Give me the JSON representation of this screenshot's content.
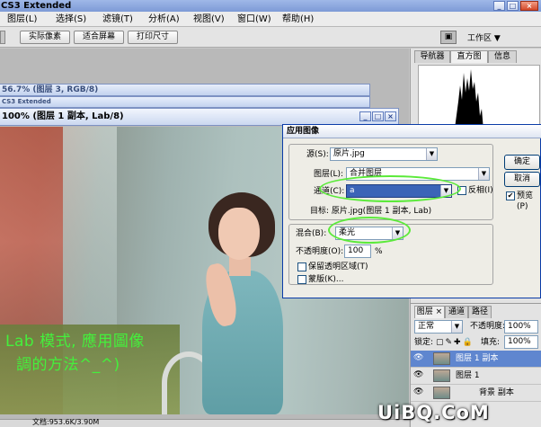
{
  "app": {
    "title": "CS3 Extended"
  },
  "menu": [
    "图层(L)",
    "选择(S)",
    "滤镜(T)",
    "分析(A)",
    "视图(V)",
    "窗口(W)",
    "帮助(H)"
  ],
  "options_bar": {
    "actual_pixels": "实际像素",
    "fit_screen": "适合屏幕",
    "print_size": "打印尺寸",
    "workspace": "工作区 ▼"
  },
  "doc1": {
    "title": "56.7% (图层 3, RGB/8)"
  },
  "doc2": {
    "title": "CS3 Extended"
  },
  "doc3": {
    "title": "100% (图层 1 副本, Lab/8)"
  },
  "panel_tabs": [
    "导航器",
    "直方图",
    "信息"
  ],
  "dialog": {
    "title": "应用图像",
    "source_label": "源(S):",
    "source_value": "原片.jpg",
    "layer_label": "图层(L):",
    "layer_value": "合并图层",
    "channel_label": "通道(C):",
    "channel_value": "a",
    "invert_label": "反相(I)",
    "target_text": "目标:  原片.jpg(图层 1 副本, Lab)",
    "blend_label": "混合(B):",
    "blend_value": "柔光",
    "opacity_label": "不透明度(O):",
    "opacity_value": "100",
    "opacity_unit": "%",
    "preserve_label": "保留透明区域(T)",
    "mask_label": "蒙版(K)...",
    "ok": "确定",
    "cancel": "取消",
    "preview": "预览(P)"
  },
  "layers_panel": {
    "tabs": [
      "图层 ×",
      "通道",
      "路径"
    ],
    "blend_mode": "正常",
    "opacity_label": "不透明度:",
    "opacity_value": "100%",
    "lock_label": "锁定:",
    "fill_label": "填充:",
    "fill_value": "100%",
    "rows": [
      "图层 1 副本",
      "图层 1",
      "背景 副本"
    ]
  },
  "caption": {
    "line1": "Lab 模式, 應用圖像",
    "line2": "調的方法^_^)"
  },
  "status": "文档:953.6K/3.90M",
  "watermark": "UiBQ.CoM"
}
